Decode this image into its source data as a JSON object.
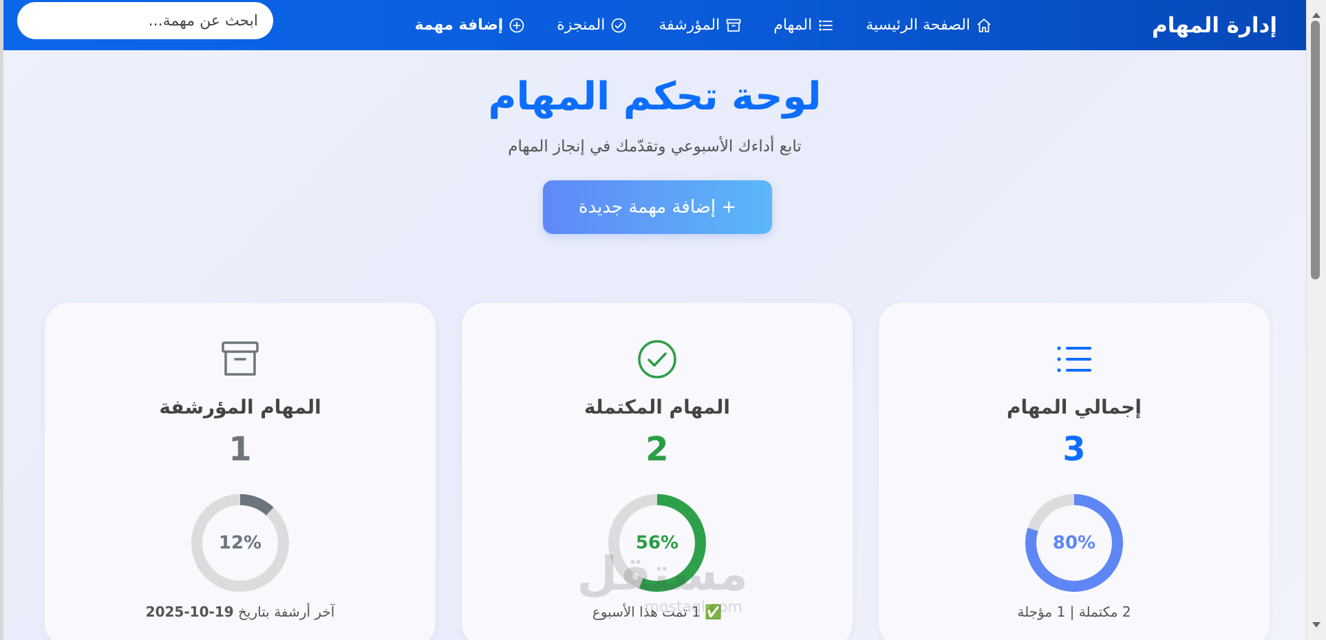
{
  "navbar": {
    "brand": "إدارة المهام",
    "links": [
      {
        "label": "الصفحة الرئيسية",
        "icon": "home-icon"
      },
      {
        "label": "المهام",
        "icon": "list-icon"
      },
      {
        "label": "المؤرشفة",
        "icon": "archive-icon"
      },
      {
        "label": "المنجزة",
        "icon": "check-circle-icon"
      },
      {
        "label": "إضافة مهمة",
        "icon": "plus-circle-icon"
      }
    ],
    "search_placeholder": "ابحث عن مهمة..."
  },
  "hero": {
    "title": "لوحة تحكم المهام",
    "subtitle": "تابع أداءك الأسبوعي وتقدّمك في إنجاز المهام",
    "button_label": "+ إضافة مهمة جديدة"
  },
  "cards": [
    {
      "title": "إجمالي المهام",
      "count": "3",
      "percent_label": "80%",
      "percent": 80,
      "color": "#0d6efd",
      "ring_color": "#5f86f5",
      "icon": "list-icon",
      "footer": "2 مكتملة | 1 مؤجلة"
    },
    {
      "title": "المهام المكتملة",
      "count": "2",
      "percent_label": "56%",
      "percent": 56,
      "color": "#2a9d45",
      "ring_color": "#2ea04a",
      "icon": "check-circle-icon",
      "footer": "✅ 1 تمت هذا الأسبوع"
    },
    {
      "title": "المهام المؤرشفة",
      "count": "1",
      "percent_label": "12%",
      "percent": 12,
      "color": "#6c757d",
      "ring_color": "#6c757d",
      "icon": "archive-icon",
      "footer_prefix": "آخر أرشفة بتاريخ",
      "footer_date": "19-10-2025"
    }
  ],
  "watermark": {
    "text": "مستقل",
    "sub": "mostaql.com"
  },
  "colors": {
    "primary": "#0d6efd",
    "success": "#2a9d45",
    "secondary": "#6c757d",
    "ring_track": "#dcdcdc"
  }
}
